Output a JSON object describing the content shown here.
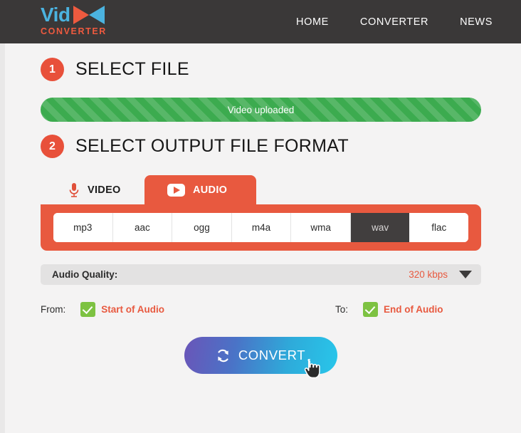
{
  "header": {
    "logo": {
      "text_primary": "Vid",
      "text_secondary": "CONVERTER",
      "icon": "bowtie-play-icon",
      "color_primary": "#4bb3e0",
      "color_secondary": "#ee5a3f"
    },
    "background": "#3a3838",
    "nav": [
      {
        "label": "HOME"
      },
      {
        "label": "CONVERTER"
      },
      {
        "label": "NEWS"
      }
    ]
  },
  "sections": {
    "step1": {
      "number": "1",
      "title": "SELECT FILE",
      "upload_status": "Video uploaded",
      "upload_bar_color": "#3cab4f"
    },
    "step2": {
      "number": "2",
      "title": "SELECT OUTPUT FILE FORMAT"
    }
  },
  "tabs": [
    {
      "label": "VIDEO",
      "icon": "microphone-icon",
      "active": false
    },
    {
      "label": "AUDIO",
      "icon": "play-button-icon",
      "active": true
    }
  ],
  "formats": [
    {
      "label": "mp3",
      "selected": false
    },
    {
      "label": "aac",
      "selected": false
    },
    {
      "label": "ogg",
      "selected": false
    },
    {
      "label": "m4a",
      "selected": false
    },
    {
      "label": "wma",
      "selected": false
    },
    {
      "label": "wav",
      "selected": true
    },
    {
      "label": "flac",
      "selected": false
    }
  ],
  "quality": {
    "label": "Audio Quality:",
    "value": "320 kbps",
    "icon": "chevron-down-icon",
    "value_color": "#e8593f"
  },
  "range": {
    "from_caption": "From:",
    "from_value": "Start of Audio",
    "from_checked": true,
    "to_caption": "To:",
    "to_value": "End of Audio",
    "to_checked": true,
    "checkbox_color": "#7dc242"
  },
  "convert": {
    "label": "CONVERT",
    "icon": "refresh-arrows-icon",
    "gradient_from": "#6a55b8",
    "gradient_to": "#28c6ea"
  },
  "cursor": {
    "type": "pointer-hand-cursor"
  },
  "accent_color": "#e8593f",
  "page_background": "#f4f3f3"
}
